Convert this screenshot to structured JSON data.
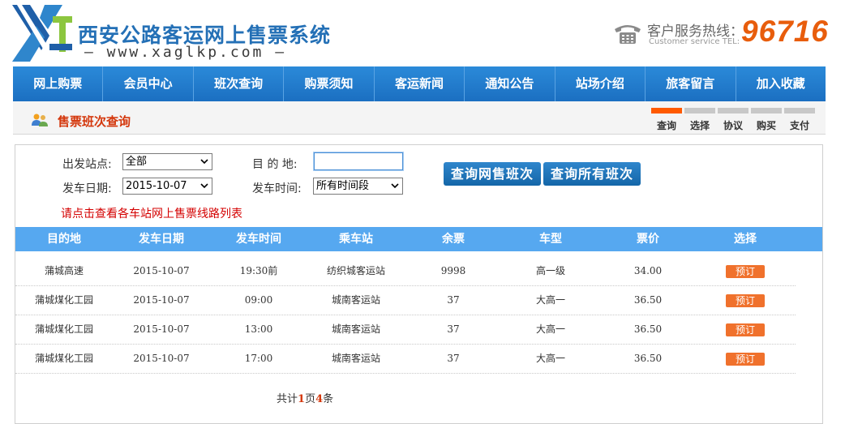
{
  "header": {
    "site_title": "西安公路客运网上售票系统",
    "site_url": "— www.xaglkp.com —",
    "hotline_label": "客户服务热线：",
    "hotline_label_en": "Customer service TEL:",
    "hotline_number": "96716",
    "brand_color": "#2470b6",
    "accent_color": "#e85d0c"
  },
  "nav": {
    "items": [
      "网上购票",
      "会员中心",
      "班次查询",
      "购票须知",
      "客运新闻",
      "通知公告",
      "站场介绍",
      "旅客留言",
      "加入收藏"
    ]
  },
  "section": {
    "title": "售票班次查询",
    "icon": "users-icon",
    "steps": [
      {
        "label": "查询",
        "active": true
      },
      {
        "label": "选择",
        "active": false
      },
      {
        "label": "协议",
        "active": false
      },
      {
        "label": "购买",
        "active": false
      },
      {
        "label": "支付",
        "active": false
      }
    ]
  },
  "search_form": {
    "departure_label": "出发站点:",
    "departure_value": "全部",
    "destination_label": "目 的 地:",
    "destination_value": "",
    "date_label": "发车日期:",
    "date_value": "2015-10-07",
    "time_label": "发车时间:",
    "time_value": "所有时间段",
    "query_online_button": "查询网售班次",
    "query_all_button": "查询所有班次",
    "route_list_link": "请点击查看各车站网上售票线路列表"
  },
  "table": {
    "columns": [
      "目的地",
      "发车日期",
      "发车时间",
      "乘车站",
      "余票",
      "车型",
      "票价",
      "选择"
    ],
    "book_label": "预订",
    "rows": [
      [
        "蒲城高速",
        "2015-10-07",
        "19:30前",
        "纺织城客运站",
        "9998",
        "高一级",
        "34.00"
      ],
      [
        "蒲城煤化工园",
        "2015-10-07",
        "09:00",
        "城南客运站",
        "37",
        "大高一",
        "36.50"
      ],
      [
        "蒲城煤化工园",
        "2015-10-07",
        "13:00",
        "城南客运站",
        "37",
        "大高一",
        "36.50"
      ],
      [
        "蒲城煤化工园",
        "2015-10-07",
        "17:00",
        "城南客运站",
        "37",
        "大高一",
        "36.50"
      ]
    ]
  },
  "pager": {
    "prefix": "共计",
    "pages": "1",
    "mid": "页",
    "count": "4",
    "suffix": "条"
  }
}
